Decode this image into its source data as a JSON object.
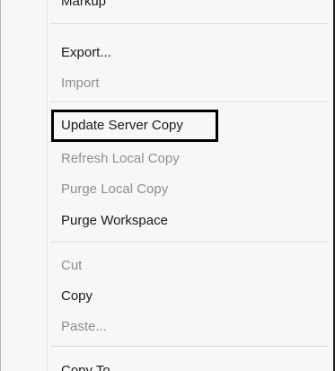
{
  "menu": {
    "items": [
      {
        "label": "Markup",
        "enabled": true
      },
      {
        "label": "Export...",
        "enabled": true
      },
      {
        "label": "Import",
        "enabled": false
      },
      {
        "label": "Update Server Copy",
        "enabled": true,
        "highlighted": true
      },
      {
        "label": "Refresh Local Copy",
        "enabled": false
      },
      {
        "label": "Purge Local Copy",
        "enabled": false
      },
      {
        "label": "Purge Workspace",
        "enabled": true
      },
      {
        "label": "Cut",
        "enabled": false
      },
      {
        "label": "Copy",
        "enabled": true
      },
      {
        "label": "Paste...",
        "enabled": false
      },
      {
        "label": "Copy To",
        "enabled": true
      }
    ]
  },
  "colors": {
    "menu_background": "#f7f7f7",
    "enabled_text": "#1a1a1a",
    "disabled_text": "#8f8f8f",
    "highlight_border": "#000000"
  }
}
